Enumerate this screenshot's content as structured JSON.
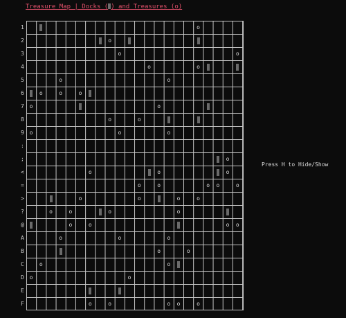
{
  "title": {
    "prefix": "Treasure Map | Docks (",
    "suffix": ") and Treasures (o)"
  },
  "hint": "Press H to Hide/Show",
  "symbols": {
    "treasure": "o",
    "dock": "dock-block"
  },
  "colors": {
    "background": "#0c0c0c",
    "title": "#e0506a",
    "grid_lines": "#c8c8c8",
    "dock": "#6a6a6a",
    "text": "#dddddd"
  },
  "grid": {
    "columns": 22,
    "rows": 22,
    "row_labels": [
      "1",
      "2",
      "3",
      "4",
      "5",
      "6",
      "7",
      "8",
      "9",
      ":",
      ";",
      "<",
      "=",
      ">",
      "?",
      "@",
      "A",
      "B",
      "C",
      "D",
      "E",
      "F"
    ],
    "cells": [
      {
        "row": 0,
        "col": 1,
        "kind": "dock"
      },
      {
        "row": 0,
        "col": 17,
        "kind": "treasure"
      },
      {
        "row": 1,
        "col": 7,
        "kind": "dock"
      },
      {
        "row": 1,
        "col": 8,
        "kind": "treasure"
      },
      {
        "row": 1,
        "col": 10,
        "kind": "dock"
      },
      {
        "row": 1,
        "col": 17,
        "kind": "dock"
      },
      {
        "row": 2,
        "col": 9,
        "kind": "treasure"
      },
      {
        "row": 2,
        "col": 21,
        "kind": "treasure"
      },
      {
        "row": 3,
        "col": 12,
        "kind": "treasure"
      },
      {
        "row": 3,
        "col": 17,
        "kind": "treasure"
      },
      {
        "row": 3,
        "col": 18,
        "kind": "dock"
      },
      {
        "row": 3,
        "col": 21,
        "kind": "dock"
      },
      {
        "row": 4,
        "col": 3,
        "kind": "treasure"
      },
      {
        "row": 4,
        "col": 14,
        "kind": "treasure"
      },
      {
        "row": 5,
        "col": 0,
        "kind": "dock"
      },
      {
        "row": 5,
        "col": 1,
        "kind": "treasure"
      },
      {
        "row": 5,
        "col": 3,
        "kind": "treasure"
      },
      {
        "row": 5,
        "col": 5,
        "kind": "treasure"
      },
      {
        "row": 5,
        "col": 6,
        "kind": "dock"
      },
      {
        "row": 6,
        "col": 0,
        "kind": "treasure"
      },
      {
        "row": 6,
        "col": 5,
        "kind": "dock"
      },
      {
        "row": 6,
        "col": 13,
        "kind": "treasure"
      },
      {
        "row": 6,
        "col": 18,
        "kind": "dock"
      },
      {
        "row": 7,
        "col": 8,
        "kind": "treasure"
      },
      {
        "row": 7,
        "col": 11,
        "kind": "treasure"
      },
      {
        "row": 7,
        "col": 14,
        "kind": "dock"
      },
      {
        "row": 7,
        "col": 17,
        "kind": "dock"
      },
      {
        "row": 8,
        "col": 0,
        "kind": "treasure"
      },
      {
        "row": 8,
        "col": 9,
        "kind": "treasure"
      },
      {
        "row": 8,
        "col": 14,
        "kind": "treasure"
      },
      {
        "row": 10,
        "col": 19,
        "kind": "dock"
      },
      {
        "row": 10,
        "col": 20,
        "kind": "treasure"
      },
      {
        "row": 11,
        "col": 6,
        "kind": "treasure"
      },
      {
        "row": 11,
        "col": 12,
        "kind": "dock"
      },
      {
        "row": 11,
        "col": 13,
        "kind": "treasure"
      },
      {
        "row": 11,
        "col": 19,
        "kind": "dock"
      },
      {
        "row": 11,
        "col": 20,
        "kind": "treasure"
      },
      {
        "row": 12,
        "col": 11,
        "kind": "treasure"
      },
      {
        "row": 12,
        "col": 13,
        "kind": "treasure"
      },
      {
        "row": 12,
        "col": 18,
        "kind": "treasure"
      },
      {
        "row": 12,
        "col": 19,
        "kind": "treasure"
      },
      {
        "row": 12,
        "col": 21,
        "kind": "treasure"
      },
      {
        "row": 13,
        "col": 2,
        "kind": "dock"
      },
      {
        "row": 13,
        "col": 5,
        "kind": "treasure"
      },
      {
        "row": 13,
        "col": 11,
        "kind": "treasure"
      },
      {
        "row": 13,
        "col": 13,
        "kind": "dock"
      },
      {
        "row": 13,
        "col": 15,
        "kind": "treasure"
      },
      {
        "row": 13,
        "col": 17,
        "kind": "treasure"
      },
      {
        "row": 14,
        "col": 2,
        "kind": "treasure"
      },
      {
        "row": 14,
        "col": 4,
        "kind": "treasure"
      },
      {
        "row": 14,
        "col": 7,
        "kind": "dock"
      },
      {
        "row": 14,
        "col": 8,
        "kind": "treasure"
      },
      {
        "row": 14,
        "col": 15,
        "kind": "treasure"
      },
      {
        "row": 14,
        "col": 20,
        "kind": "dock"
      },
      {
        "row": 15,
        "col": 0,
        "kind": "dock"
      },
      {
        "row": 15,
        "col": 4,
        "kind": "treasure"
      },
      {
        "row": 15,
        "col": 6,
        "kind": "treasure"
      },
      {
        "row": 15,
        "col": 15,
        "kind": "dock"
      },
      {
        "row": 15,
        "col": 20,
        "kind": "treasure"
      },
      {
        "row": 15,
        "col": 21,
        "kind": "treasure"
      },
      {
        "row": 16,
        "col": 3,
        "kind": "treasure"
      },
      {
        "row": 16,
        "col": 9,
        "kind": "treasure"
      },
      {
        "row": 16,
        "col": 14,
        "kind": "treasure"
      },
      {
        "row": 17,
        "col": 3,
        "kind": "dock"
      },
      {
        "row": 17,
        "col": 13,
        "kind": "treasure"
      },
      {
        "row": 17,
        "col": 16,
        "kind": "treasure"
      },
      {
        "row": 18,
        "col": 1,
        "kind": "treasure"
      },
      {
        "row": 18,
        "col": 14,
        "kind": "treasure"
      },
      {
        "row": 18,
        "col": 15,
        "kind": "dock"
      },
      {
        "row": 19,
        "col": 0,
        "kind": "treasure"
      },
      {
        "row": 19,
        "col": 10,
        "kind": "treasure"
      },
      {
        "row": 20,
        "col": 6,
        "kind": "dock"
      },
      {
        "row": 20,
        "col": 9,
        "kind": "dock"
      },
      {
        "row": 21,
        "col": 6,
        "kind": "treasure"
      },
      {
        "row": 21,
        "col": 8,
        "kind": "treasure"
      },
      {
        "row": 21,
        "col": 14,
        "kind": "treasure"
      },
      {
        "row": 21,
        "col": 15,
        "kind": "treasure"
      },
      {
        "row": 21,
        "col": 17,
        "kind": "treasure"
      }
    ]
  }
}
